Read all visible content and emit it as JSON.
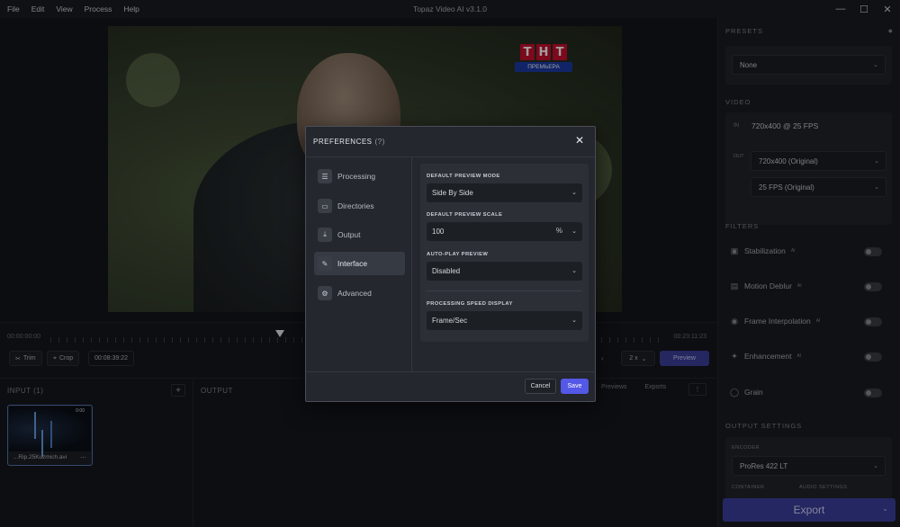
{
  "titlebar": {
    "menu": [
      "File",
      "Edit",
      "View",
      "Process",
      "Help"
    ],
    "app_title": "Topaz Video AI  v3.1.0"
  },
  "video_overlay": {
    "channel_logo": [
      "Т",
      "Н",
      "Т"
    ],
    "channel_sub": "ПРЕМЬЕРА"
  },
  "timeline": {
    "start": "00:00:00:00",
    "end": "00:23:11:23"
  },
  "controls": {
    "trim_label": "Trim",
    "crop_label": "Crop",
    "current_time": "00:08:39:22",
    "speed": "2 x",
    "preview_label": "Preview"
  },
  "bottom": {
    "input_header": "INPUT (1)",
    "output_header": "OUTPUT",
    "output_tabs": [
      "Previews",
      "Exports"
    ],
    "file_name": "...Rip.25Kuzmich.avi",
    "thumb_badge": "0:00"
  },
  "sidebar": {
    "presets_header": "PRESETS",
    "preset_value": "None",
    "video_header": "VIDEO",
    "in_label": "IN",
    "in_resolution": "720x400 @ 25 FPS",
    "out_label": "OUT",
    "out_resolution": "720x400 (Original)",
    "out_fps": "25 FPS (Original)",
    "filters_header": "FILTERS",
    "filters": [
      {
        "label": "Stabilization",
        "icon": "stabilization-icon",
        "enabled": false
      },
      {
        "label": "Motion Deblur",
        "icon": "motion-deblur-icon",
        "enabled": false
      },
      {
        "label": "Frame Interpolation",
        "icon": "frame-interpolation-icon",
        "enabled": false
      },
      {
        "label": "Enhancement",
        "icon": "enhancement-icon",
        "enabled": false
      },
      {
        "label": "Grain",
        "icon": "grain-icon",
        "enabled": false
      }
    ],
    "output_settings_header": "OUTPUT SETTINGS",
    "encoder_label": "ENCODER",
    "encoder_value": "ProRes 422 LT",
    "container_label": "CONTAINER",
    "audio_label": "AUDIO SETTINGS",
    "export_label": "Export"
  },
  "modal": {
    "title": "PREFERENCES",
    "help": "(?)",
    "nav": [
      {
        "label": "Processing",
        "icon": "processing-icon",
        "active": false
      },
      {
        "label": "Directories",
        "icon": "folder-icon",
        "active": false
      },
      {
        "label": "Output",
        "icon": "download-icon",
        "active": false
      },
      {
        "label": "Interface",
        "icon": "interface-icon",
        "active": true
      },
      {
        "label": "Advanced",
        "icon": "gear-icon",
        "active": false
      }
    ],
    "default_preview_mode_label": "DEFAULT PREVIEW MODE",
    "default_preview_mode_value": "Side By Side",
    "default_preview_scale_label": "DEFAULT PREVIEW SCALE",
    "default_preview_scale_value": "100",
    "default_preview_scale_unit": "%",
    "auto_play_label": "AUTO-PLAY PREVIEW",
    "auto_play_value": "Disabled",
    "speed_display_label": "PROCESSING SPEED DISPLAY",
    "speed_display_value": "Frame/Sec",
    "cancel_label": "Cancel",
    "save_label": "Save"
  },
  "colors": {
    "accent": "#5458e6",
    "export_button": "#3d3f9e",
    "background": "#15171c",
    "modal_bg": "#24272d"
  }
}
